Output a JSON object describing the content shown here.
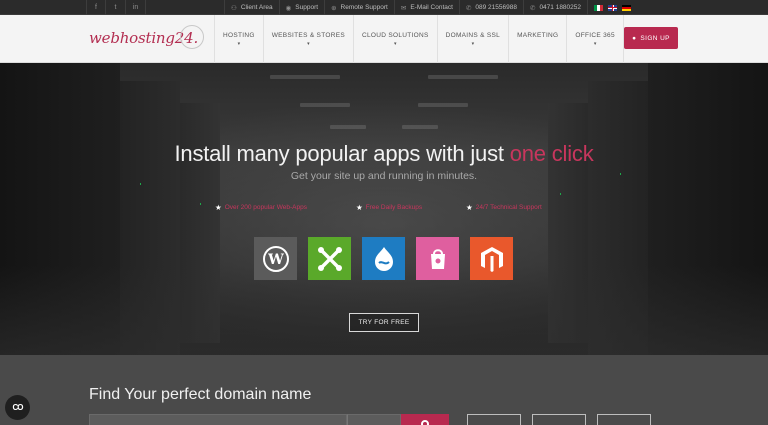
{
  "topbar": {
    "social": [
      {
        "icon": "facebook-icon",
        "glyph": "f"
      },
      {
        "icon": "twitter-icon",
        "glyph": "t"
      },
      {
        "icon": "linkedin-icon",
        "glyph": "in"
      }
    ],
    "links": [
      {
        "icon": "users-icon",
        "glyph": "⚇",
        "label": "Client Area"
      },
      {
        "icon": "support-icon",
        "glyph": "◉",
        "label": "Support"
      },
      {
        "icon": "remote-icon",
        "glyph": "⊕",
        "label": "Remote Support"
      },
      {
        "icon": "mail-icon",
        "glyph": "✉",
        "label": "E-Mail Contact"
      },
      {
        "icon": "phone-icon",
        "glyph": "✆",
        "label": "089 21556988"
      },
      {
        "icon": "phone-icon",
        "glyph": "✆",
        "label": "0471 1880252"
      }
    ]
  },
  "logo": {
    "text": "webhosting24."
  },
  "nav": {
    "items": [
      {
        "label": "HOSTING",
        "caret": "▾"
      },
      {
        "label": "WEBSITES & STORES",
        "caret": "▾"
      },
      {
        "label": "CLOUD SOLUTIONS",
        "caret": "▾"
      },
      {
        "label": "DOMAINS & SSL",
        "caret": "▾"
      },
      {
        "label": "MARKETING",
        "caret": ""
      },
      {
        "label": "OFFICE 365",
        "caret": "▾"
      }
    ],
    "signup": {
      "label": "SIGN UP",
      "icon": "user-icon"
    }
  },
  "hero": {
    "title_main": "Install many popular apps with just ",
    "title_accent": "one click",
    "subtitle": "Get your site up and running in minutes.",
    "features": [
      "Over 200 popular Web-Apps",
      "Free Daily Backups",
      "24/7 Technical Support"
    ],
    "apps": [
      {
        "name": "wordpress",
        "color": "#5b5b5b"
      },
      {
        "name": "joomla",
        "color": "#5aa92a"
      },
      {
        "name": "drupal",
        "color": "#1e7cc2"
      },
      {
        "name": "prestashop",
        "color": "#df5f9f"
      },
      {
        "name": "magento",
        "color": "#e9582c"
      }
    ],
    "cta": "TRY FOR FREE"
  },
  "domain": {
    "title": "Find Your perfect domain name"
  },
  "colors": {
    "brand": "#b8294f",
    "accent_text": "#c8365d"
  }
}
